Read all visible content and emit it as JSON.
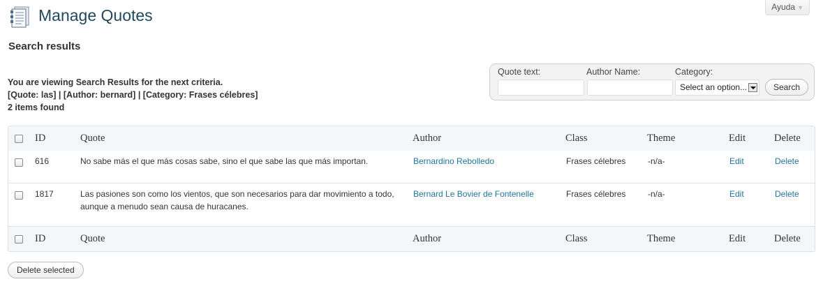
{
  "header": {
    "title": "Manage Quotes",
    "help_label": "Ayuda",
    "icon": "quotes-page-icon"
  },
  "subtitle": "Search results",
  "criteria": {
    "line1": "You are viewing Search Results for the next criteria.",
    "line2": "[Quote: las] | [Author: bernard] | [Category: Frases célebres]",
    "line3": "2 items found"
  },
  "search": {
    "quote_label": "Quote text:",
    "author_label": "Author Name:",
    "category_label": "Category:",
    "quote_value": "",
    "author_value": "",
    "category_selected": "Select an option...",
    "button_label": "Search"
  },
  "table": {
    "columns": [
      "ID",
      "Quote",
      "Author",
      "Class",
      "Theme",
      "Edit",
      "Delete"
    ],
    "rows": [
      {
        "id": "616",
        "quote": "No sabe más el que más cosas sabe, sino el que sabe las que más importan.",
        "author": "Bernardino Rebolledo",
        "class": "Frases célebres",
        "theme": "-n/a-",
        "edit": "Edit",
        "delete": "Delete"
      },
      {
        "id": "1817",
        "quote": "Las pasiones son como los vientos, que son necesarios para dar movimiento a todo, aunque a menudo sean causa de huracanes.",
        "author": "Bernard Le Bovier de Fontenelle",
        "class": "Frases célebres",
        "theme": "-n/a-",
        "edit": "Edit",
        "delete": "Delete"
      }
    ]
  },
  "bulk": {
    "delete_selected_label": "Delete selected"
  },
  "colors": {
    "title": "#21495e",
    "link": "#21759b",
    "header_bg": "#f3f7fa"
  }
}
